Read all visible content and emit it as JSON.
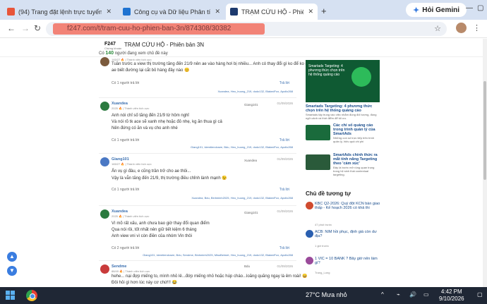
{
  "browser": {
    "tabs": [
      {
        "title": "(94) Trang đặt lệnh trực tuyến E",
        "active": false,
        "icon_color": "#e8553a"
      },
      {
        "title": "Công cụ và Dữ liệu Phân tích kỹ",
        "active": false,
        "icon_color": "#1f73d1"
      },
      {
        "title": "TRẠM CỨU HỘ - Phiên bản 3N",
        "active": true,
        "icon_color": "#1d3a6e"
      }
    ],
    "gemini_label": "Hỏi Gemini",
    "url": "f247.com/t/tram-cuu-ho-phien-ban-3n/874308/30382"
  },
  "site": {
    "logo": "F247",
    "logo_sub": "Chứng khoán",
    "title": "TRẠM CỨU HỘ - Phiên bản 3N",
    "viewers_count": "140",
    "viewers_text": "người đang xem chủ đề này"
  },
  "posts": [
    {
      "name": "",
      "meta": "",
      "date": "",
      "lines": [
        "Tuần trước a view thị trường tăng đến 21/9 nên ae vào hàng hơi bị nhiều... Anh có thay đổi gì ko để ko mai",
        "ae biết đường lại cắt bỏ hàng đây nào 😊"
      ],
      "likes": "Có 1 người trả lời",
      "likers": "Xuandea, Heo_huong_219, dodo132, BlakedFox, Apollo268",
      "reply": "Trả lời",
      "avatar_color": "#7b5a3c"
    },
    {
      "name": "Xuandea",
      "meta": "2025 🔥 | Thành viên tích cực",
      "date": "01/09/2026",
      "quote": "Giang101",
      "lines": [
        "Anh nói chỉ số tăng đến 21/9 từ hôm nghỉ",
        "Và nói rõ tk ace sẽ xanh nhẹ hoặc đỏ nhẹ, kg ăn thua gì cả",
        "Nên đứng có ăn và vụ cho anh nhé"
      ],
      "likes": "Có 1 người trả lời",
      "likers": "Giang101, kiemtiendcsee, Bdu, Heo_huong_219, dodo132, BlakedFox, Apollo268",
      "reply": "Trả lời",
      "avatar_color": "#2b7a3f"
    },
    {
      "name": "Giang101",
      "meta": "165/27 🔥 | Thành viên tích cực",
      "date": "01/09/2026",
      "quote": "Xuandea",
      "lines": [
        "Ấn vụ gì đâu, e cũng trần trở cho ae thôi...",
        "Vậy là vẫn tăng đến 21/9, thị trường điều chỉnh lành mạnh 😉"
      ],
      "likes": "Có 1 người trả lời",
      "likers": "Xuandea, Bdu, Binhminh2025, Heo_huong_219, dodo132, BlakedFox, Apollo268",
      "reply": "Trả lời",
      "avatar_color": "#4a78c4"
    },
    {
      "name": "Xuandea",
      "meta": "2025 🔥 | Thành viên tích cực",
      "date": "01/09/2026",
      "quote": "Giang101",
      "lines": [
        "Vì mõ rất xấu, anh chưa bao giờ thay đổi quan điểm",
        "Qua nói rồi, tốt nhất nên giữ tiết kiệm 6 tháng",
        "Anh view vni vì còn điền của nhóm Vin thôi"
      ],
      "likes": "Có 2 người trả lời",
      "likers": "Giang101, kiemtiendcsee, Bdu, Sendme, Binhminh2025, MissBeimet, Heo_huong_219, dodo132, BlakedFox, Apollo268",
      "reply": "Trả lời",
      "avatar_color": "#2b7a3f"
    },
    {
      "name": "Sendme",
      "meta": "88/49 🔥 | Thành viên tích cực",
      "date": "01/09/2026",
      "quote": "Bdu",
      "lines": [
        "hehe... nại đợp miếng to, mình nhỏ lẻ...đớp miếng nhỏ hoặc húp cháo...loăng quăng ngay là êm roài! 😄",
        "Đôi hỏi gì hơn lúc này cơ chứ!!! 😂"
      ],
      "likes": "",
      "likers": "",
      "reply": "",
      "avatar_color": "#c93b3b"
    }
  ],
  "sidebar_ad": {
    "banner_text": "Smartads Targeting: 4 phương thức chọn trên hệ thống quảng cáo",
    "title": "Smartads Targeting: 4 phương thức chọn trên hệ thống quảng cáo",
    "desc": "Smartads tập trung vào việc nhắm đúng đối tượng, đúng ngữ cảnh và thời điểm để tối ưu.",
    "items": [
      {
        "title": "Các chỉ số quảng cáo trong trình quản lý của SmartAds",
        "desc": "Những con số trực tiếp trên trình quản lý, hiệu quả chi phí",
        "color": "#1a6b3c"
      },
      {
        "title": "SmartAds chính thức ra mắt tính năng Targeting theo 'cảm xúc'",
        "desc": "Đây là bước mở rộng quan trọng trong hệ sinh thái contextual targeting.",
        "color": "#2a5a3a"
      }
    ]
  },
  "related": {
    "heading": "Chủ đề tương tự",
    "items": [
      {
        "title": "KBC Q2-2026: Quý đột KCN bàn giao thấp - Kế hoạch 2026 có khả thi",
        "sub": "47 phút trước",
        "color": "#d04b2f"
      },
      {
        "title": "ACB: NIM hồi phục, định giá còn dư địa?",
        "sub": "1 giờ trước",
        "color": "#2a5fb0"
      },
      {
        "title": "1 VIC = 10 BANK ? Bây giờ nên làm gì?",
        "sub": "Trang_Long",
        "color": "#9a4a9a"
      }
    ]
  },
  "taskbar": {
    "weather": "27°C  Mưa nhỏ",
    "time": "4:42 PM",
    "date": "9/10/2026"
  }
}
